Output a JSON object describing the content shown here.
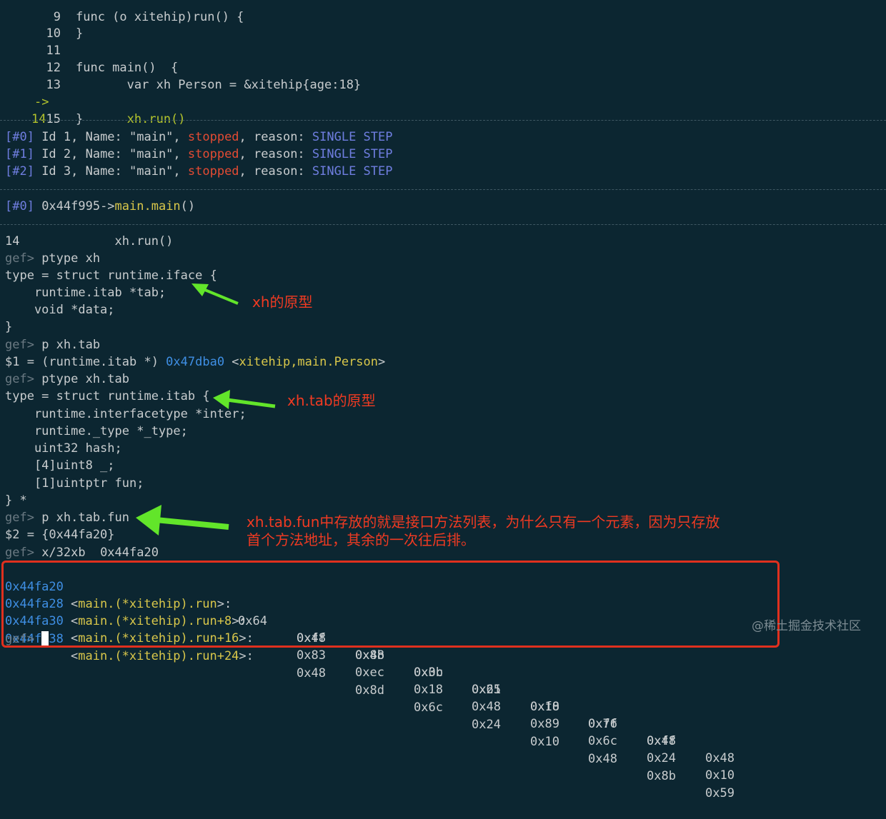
{
  "source": {
    "lines": [
      {
        "num": "9",
        "text": "func (o xitehip)run() {"
      },
      {
        "num": "10",
        "text": "}"
      },
      {
        "num": "11",
        "text": ""
      },
      {
        "num": "12",
        "text": "func main()  {"
      },
      {
        "num": "13",
        "text": "       var xh Person = &xitehip{age:18}"
      },
      {
        "num": "14",
        "text": "       xh.run()",
        "current": true,
        "marker": "->"
      },
      {
        "num": "15",
        "text": "}"
      }
    ]
  },
  "threads": [
    {
      "id": "[#0]",
      "text": " Id 1, Name: \"main\", ",
      "state": "stopped",
      "reason_label": ", reason: ",
      "reason": "SINGLE STEP"
    },
    {
      "id": "[#1]",
      "text": " Id 2, Name: \"main\", ",
      "state": "stopped",
      "reason_label": ", reason: ",
      "reason": "SINGLE STEP"
    },
    {
      "id": "[#2]",
      "text": " Id 3, Name: \"main\", ",
      "state": "stopped",
      "reason_label": ", reason: ",
      "reason": "SINGLE STEP"
    }
  ],
  "trace": {
    "frame": "[#0]",
    "addr": " 0x44f995->",
    "func": "main.main",
    "suffix": "()"
  },
  "console": {
    "l1": "14             xh.run()",
    "prompt": "gef>",
    "cmd1": " ptype xh",
    "t1": "type = struct runtime.iface {",
    "t2": "    runtime.itab *tab;",
    "t3": "    void *data;",
    "t4": "}",
    "cmd2": " p xh.tab",
    "r1_pre": "$1 = (runtime.itab *) ",
    "r1_addr": "0x47dba0",
    "r1_sym_open": " <",
    "r1_sym": "xitehip,main.Person",
    "r1_sym_close": ">",
    "cmd3": " ptype xh.tab",
    "s1": "type = struct runtime.itab {",
    "s2": "    runtime.interfacetype *inter;",
    "s3": "    runtime._type *_type;",
    "s4": "    uint32 hash;",
    "s5": "    [4]uint8 _;",
    "s6": "    [1]uintptr fun;",
    "s7": "} *",
    "cmd4": " p xh.tab.fun",
    "r2": "$2 = {0x44fa20}",
    "cmd5": " x/32xb  0x44fa20"
  },
  "memory": [
    {
      "addr": "0x44fa20",
      "sym": "main.(*xitehip).run",
      "off": ">: ",
      "bytes": [
        "0x64",
        "0x48",
        "0x8b",
        "0x0c",
        "0x25",
        "0xf8",
        "0xff",
        "0xff"
      ]
    },
    {
      "addr": "0x44fa28",
      "sym": "main.(*xitehip).run+8",
      "off": ">:",
      "bytes": [
        "0xff",
        "0x48",
        "0x3b",
        "0x61",
        "0x10",
        "0x76",
        "0x48",
        "0x48"
      ]
    },
    {
      "addr": "0x44fa30",
      "sym": "main.(*xitehip).run+16",
      "off": ">:",
      "bytes": [
        "0x83",
        "0xec",
        "0x18",
        "0x48",
        "0x89",
        "0x6c",
        "0x24",
        "0x10"
      ]
    },
    {
      "addr": "0x44fa38",
      "sym": "main.(*xitehip).run+24",
      "off": ">:",
      "bytes": [
        "0x48",
        "0x8d",
        "0x6c",
        "0x24",
        "0x10",
        "0x48",
        "0x8b",
        "0x59"
      ]
    }
  ],
  "last_prompt": "gef>",
  "annotations": {
    "a1": "xh的原型",
    "a2": "xh.tab的原型",
    "a3_l1": "xh.tab.fun中存放的就是接口方法列表，为什么只有一个元素，因为只存放",
    "a3_l2": "首个方法地址，其余的一次往后排。"
  },
  "watermark": "@稀土掘金技术社区",
  "colors": {
    "background": "#0c2631",
    "arrow": "#62e52a",
    "annotation": "#f03a22",
    "box": "#e0301e",
    "current_line": "#b5c52c",
    "stopped": "#e44b33",
    "reason": "#6f7ee0",
    "address": "#3f8fe4",
    "symbol": "#d9c74a"
  }
}
